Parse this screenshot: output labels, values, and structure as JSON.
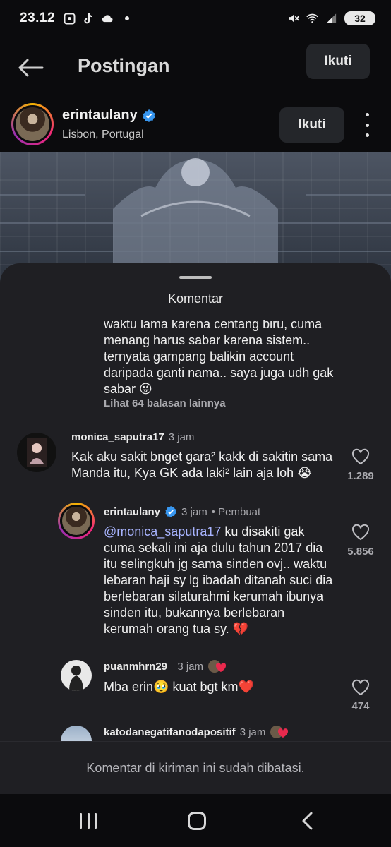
{
  "status_bar": {
    "time": "23.12",
    "battery": "32",
    "icons": [
      "screenshot-icon",
      "tiktok-icon",
      "cloud-icon",
      "dot-icon",
      "mute-icon",
      "wifi-icon",
      "signal-icon"
    ]
  },
  "header": {
    "title": "Postingan",
    "follow_label": "Ikuti"
  },
  "post": {
    "author": "erintaulany",
    "location": "Lisbon, Portugal",
    "follow_label": "Ikuti"
  },
  "comments_sheet": {
    "title": "Komentar",
    "partial_text": "waktu lama karena centang biru, cuma menang harus sabar karena sistem.. ternyata gampang balikin account daripada ganti nama.. saya juga udh gak sabar 😜",
    "view_more": "Lihat 64 balasan lainnya",
    "comments": [
      {
        "username": "monica_saputra17",
        "time": "3 jam",
        "text": "Kak aku sakit bnget gara² kakk di sakitin sama Manda itu, Kya GK ada laki² lain aja loh 😭",
        "likes": "1.289"
      },
      {
        "username": "erintaulany",
        "time": "3 jam",
        "badge": "• Pembuat",
        "mention": "@monica_saputra17",
        "text": " ku disakiti gak cuma sekali ini aja dulu tahun 2017 dia itu selingkuh jg sama sinden ovj.. waktu lebaran haji sy lg ibadah ditanah suci dia berlebaran silaturahmi kerumah ibunya sinden itu, bukannya berlebaran kerumah orang tua sy. 💔",
        "likes": "5.856"
      },
      {
        "username": "puanmhrn29_",
        "time": "3 jam",
        "text": "Mba erin🥹 kuat bgt km❤️",
        "likes": "474"
      },
      {
        "username": "katodanegatifanodapositif",
        "time": "3 jam",
        "text": "",
        "likes": ""
      }
    ],
    "restricted_notice": "Komentar di kiriman ini sudah dibatasi."
  },
  "colors": {
    "background": "#0b0b0d",
    "sheet": "#1f1f23",
    "mention": "#a8b4ff",
    "verified": "#3897f0",
    "secondary_text": "#a9a9ae"
  }
}
